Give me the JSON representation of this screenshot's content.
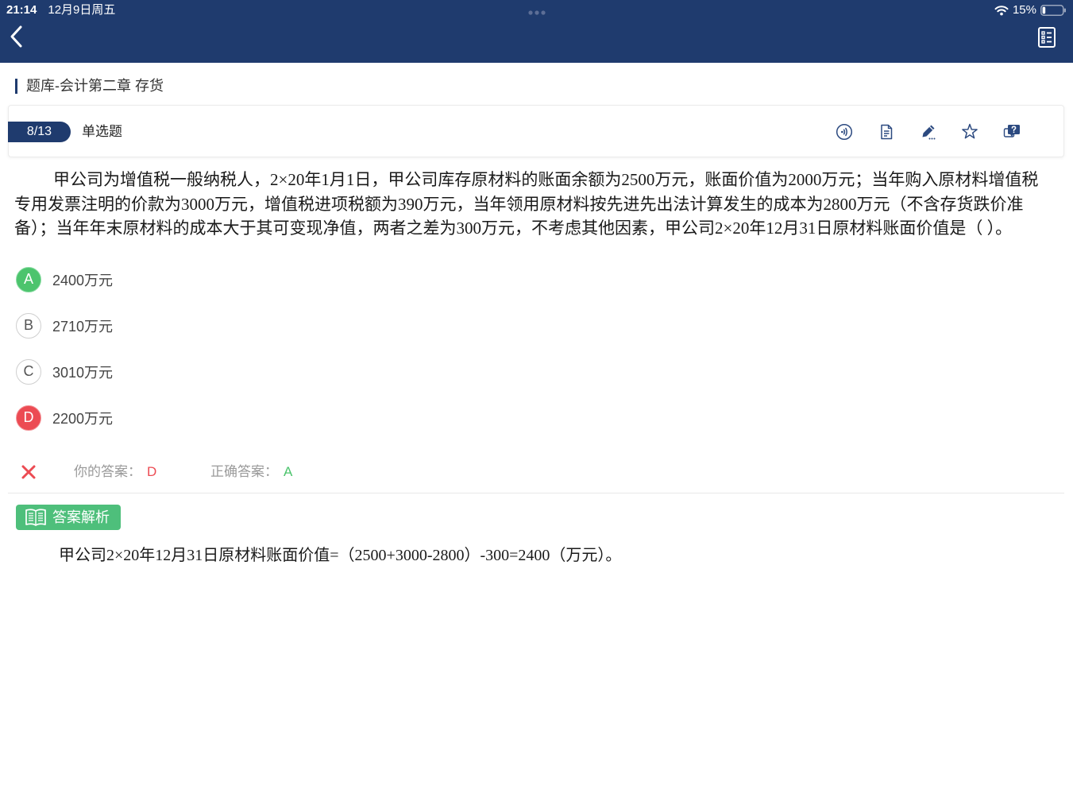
{
  "status_bar": {
    "time": "21:14",
    "date": "12月9日周五",
    "battery_text": "15%",
    "battery_level": 0.15
  },
  "breadcrumb": "题库-会计第二章 存货",
  "question_header": {
    "progress": "8/13",
    "type": "单选题",
    "tool_icons": [
      "audio-icon",
      "notes-icon",
      "edit-pencil-icon",
      "favorite-star-icon",
      "ask-question-icon"
    ]
  },
  "question": {
    "text": "甲公司为增值税一般纳税人，2×20年1月1日，甲公司库存原材料的账面余额为2500万元，账面价值为2000万元；当年购入原材料增值税专用发票注明的价款为3000万元，增值税进项税额为390万元，当年领用原材料按先进先出法计算发生的成本为2800万元（不含存货跌价准备）；当年年末原材料的成本大于其可变现净值，两者之差为300万元，不考虑其他因素，甲公司2×20年12月31日原材料账面价值是（ ）。"
  },
  "options": [
    {
      "letter": "A",
      "text": "2400万元",
      "correct": true,
      "selected": false
    },
    {
      "letter": "B",
      "text": "2710万元",
      "correct": false,
      "selected": false
    },
    {
      "letter": "C",
      "text": "3010万元",
      "correct": false,
      "selected": false
    },
    {
      "letter": "D",
      "text": "2200万元",
      "correct": false,
      "selected": true
    }
  ],
  "result": {
    "status_icon": "wrong-cross-icon",
    "your_answer_label": "你的答案：",
    "your_answer": "D",
    "correct_answer_label": "正确答案：",
    "correct_answer": "A"
  },
  "analysis": {
    "icon": "book-icon",
    "label": "答案解析",
    "text": "甲公司2×20年12月31日原材料账面价值=（2500+3000-2800）-300=2400（万元）。"
  },
  "colors": {
    "header": "#1f3b6e",
    "correct": "#4cc46d",
    "wrong": "#ec4b53",
    "analysis_badge": "#4ebf7b",
    "toolbar_icon": "#2c4a80"
  }
}
